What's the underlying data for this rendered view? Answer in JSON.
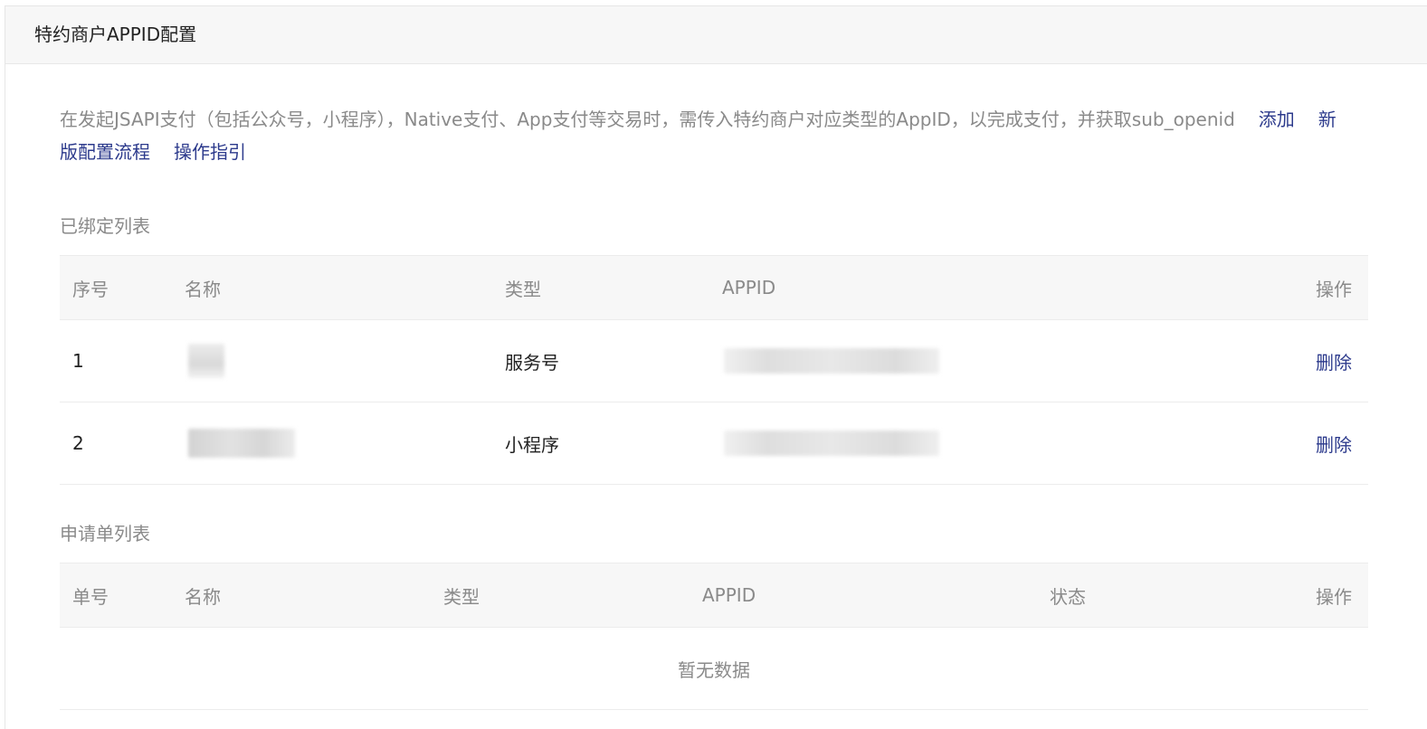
{
  "header": {
    "title": "特约商户APPID配置"
  },
  "description": {
    "text": "在发起JSAPI支付（包括公众号，小程序），Native支付、App支付等交易时，需传入特约商户对应类型的AppID，以完成支付，并获取sub_openid",
    "links": {
      "add": "添加",
      "new_flow": "新版配置流程",
      "guide": "操作指引"
    }
  },
  "bound_list": {
    "title": "已绑定列表",
    "columns": {
      "index": "序号",
      "name": "名称",
      "type": "类型",
      "appid": "APPID",
      "action": "操作"
    },
    "rows": [
      {
        "index": "1",
        "type": "服务号",
        "action": "删除"
      },
      {
        "index": "2",
        "type": "小程序",
        "action": "删除"
      }
    ]
  },
  "application_list": {
    "title": "申请单列表",
    "columns": {
      "order_no": "单号",
      "name": "名称",
      "type": "类型",
      "appid": "APPID",
      "status": "状态",
      "action": "操作"
    },
    "empty_text": "暂无数据"
  }
}
